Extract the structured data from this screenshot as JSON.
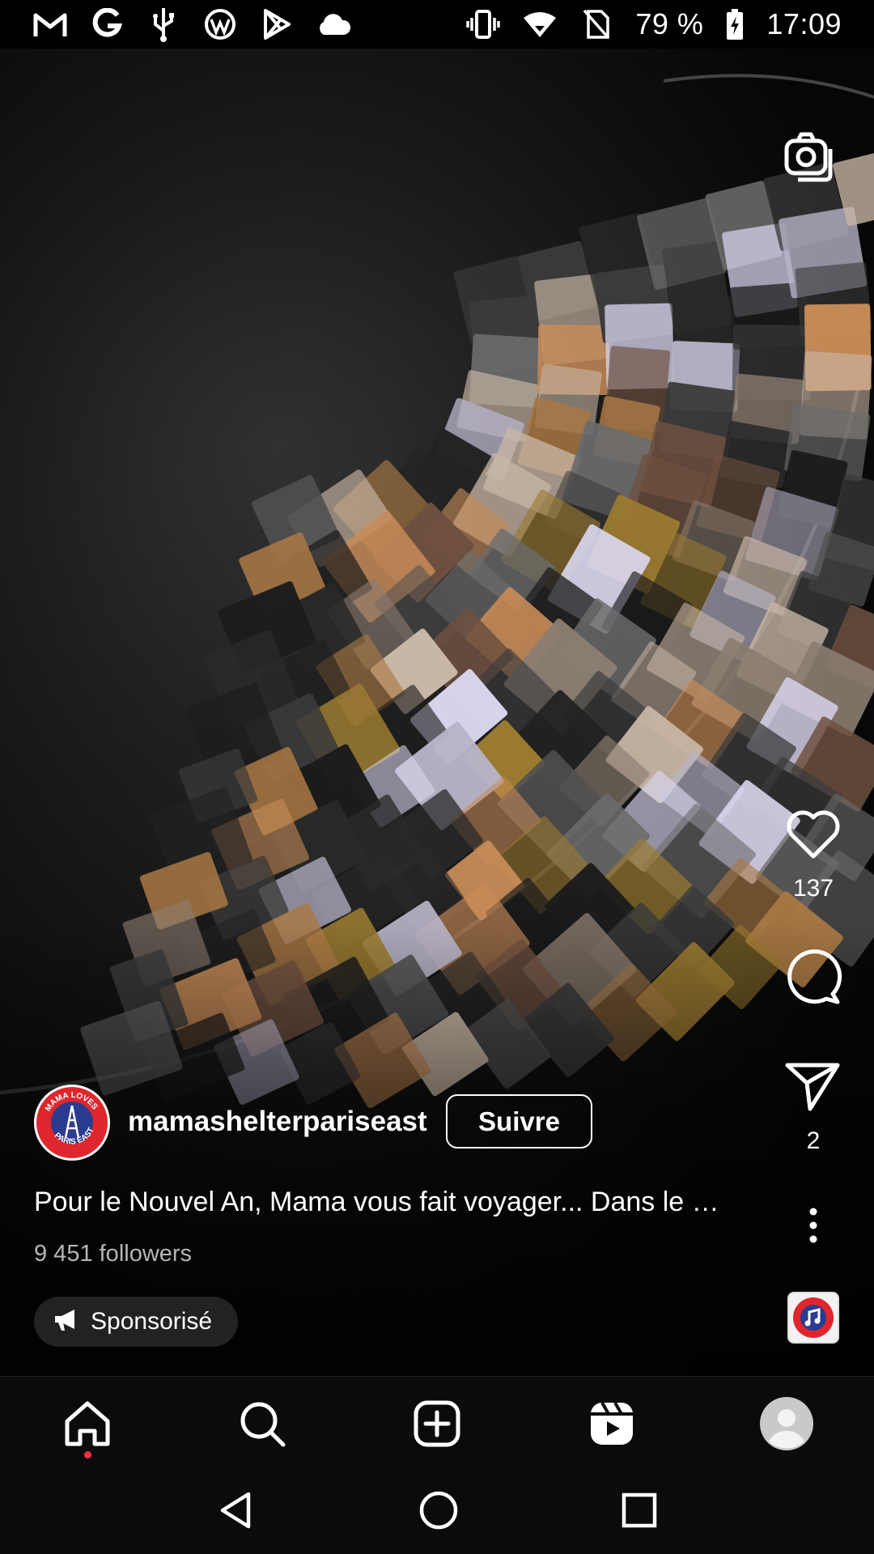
{
  "status_bar": {
    "notification_icons": [
      "gmail-icon",
      "google-icon",
      "usb-icon",
      "wordpress-icon",
      "play-store-icon",
      "cloud-icon"
    ],
    "system_icons": [
      "vibrate-icon",
      "wifi-icon",
      "no-sim-icon"
    ],
    "battery": "79 %",
    "time": "17:09"
  },
  "reel": {
    "camera_icon": "camera-icon",
    "like_count": "137",
    "comment_icon": "comment-icon",
    "share_count": "2",
    "author": {
      "username": "mamashelterpariseast",
      "avatar_text": "MAMA LOVES PARIS EAST",
      "follow_label": "Suivre",
      "followers": "9 451 followers"
    },
    "caption": "Pour le Nouvel An, Mama vous fait voyager... Dans le …",
    "sponsored_label": "Sponsorisé"
  },
  "bottom_nav": {
    "items": [
      "home-icon",
      "search-icon",
      "create-icon",
      "reels-icon",
      "profile-icon"
    ],
    "active": "home"
  },
  "system_nav": [
    "back-icon",
    "home-circle-icon",
    "recents-icon"
  ],
  "colors": {
    "background": "#000000",
    "accent_dot": "#ff3040",
    "logo_red": "#e0262d",
    "logo_blue": "#2b3b8f"
  }
}
